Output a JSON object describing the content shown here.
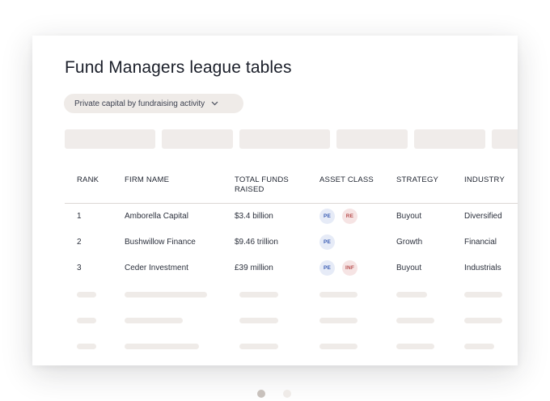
{
  "title": "Fund Managers league tables",
  "filter": {
    "label": "Private capital by fundraising activity",
    "icon": "chevron-down-icon"
  },
  "table": {
    "headers": {
      "rank": "RANK",
      "firm": "FIRM NAME",
      "funds_line1": "TOTAL FUNDS",
      "funds_line2": "RAISED",
      "asset_class": "ASSET CLASS",
      "strategy": "STRATEGY",
      "industry": "INDUSTRY"
    },
    "rows": [
      {
        "rank": "1",
        "firm": "Amborella Capital",
        "funds": "$3.4 billion",
        "badges": [
          "PE",
          "RE"
        ],
        "strategy": "Buyout",
        "industry": "Diversified"
      },
      {
        "rank": "2",
        "firm": "Bushwillow Finance",
        "funds": "$9.46 trillion",
        "badges": [
          "PE"
        ],
        "strategy": "Growth",
        "industry": "Financial"
      },
      {
        "rank": "3",
        "firm": "Ceder Investment",
        "funds": "£39 million",
        "badges": [
          "PE",
          "INF"
        ],
        "strategy": "Buyout",
        "industry": "Industrials"
      }
    ]
  },
  "colors": {
    "pe_badge": "#e6ebf7",
    "re_badge": "#f6e4e4",
    "skeleton": "#efebe8"
  },
  "pagination": {
    "pages": 2,
    "active": 1
  }
}
